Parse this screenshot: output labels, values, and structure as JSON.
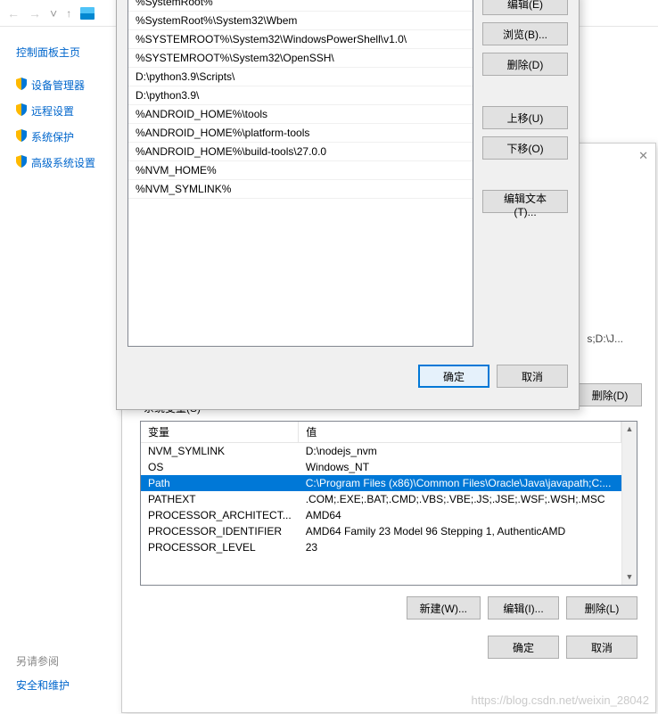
{
  "nav": {
    "back": "←",
    "forward": "→",
    "up": "↑"
  },
  "sidebar": {
    "home": "控制面板主页",
    "items": [
      {
        "label": "设备管理器"
      },
      {
        "label": "远程设置"
      },
      {
        "label": "系统保护"
      },
      {
        "label": "高级系统设置"
      }
    ],
    "footer_title": "另请参阅",
    "footer_link": "安全和维护"
  },
  "path_dialog": {
    "entries": [
      "%SystemRoot%",
      "%SystemRoot%\\System32\\Wbem",
      "%SYSTEMROOT%\\System32\\WindowsPowerShell\\v1.0\\",
      "%SYSTEMROOT%\\System32\\OpenSSH\\",
      "D:\\python3.9\\Scripts\\",
      "D:\\python3.9\\",
      "%ANDROID_HOME%\\tools",
      "%ANDROID_HOME%\\platform-tools",
      "%ANDROID_HOME%\\build-tools\\27.0.0",
      "%NVM_HOME%",
      "%NVM_SYMLINK%"
    ],
    "buttons": {
      "edit": "编辑(E)",
      "browse": "浏览(B)...",
      "delete": "删除(D)",
      "move_up": "上移(U)",
      "move_down": "下移(O)",
      "edit_text": "编辑文本(T)..."
    },
    "ok": "确定",
    "cancel": "取消"
  },
  "env_dialog": {
    "close": "✕",
    "truncated": "s;D:\\J...",
    "delete_btn": "删除(D)",
    "sys_label": "系统变量(S)",
    "columns": {
      "var": "变量",
      "val": "值"
    },
    "rows": [
      {
        "name": "NVM_SYMLINK",
        "value": "D:\\nodejs_nvm"
      },
      {
        "name": "OS",
        "value": "Windows_NT"
      },
      {
        "name": "Path",
        "value": "C:\\Program Files (x86)\\Common Files\\Oracle\\Java\\javapath;C:...",
        "selected": true
      },
      {
        "name": "PATHEXT",
        "value": ".COM;.EXE;.BAT;.CMD;.VBS;.VBE;.JS;.JSE;.WSF;.WSH;.MSC"
      },
      {
        "name": "PROCESSOR_ARCHITECT...",
        "value": "AMD64"
      },
      {
        "name": "PROCESSOR_IDENTIFIER",
        "value": "AMD64 Family 23 Model 96 Stepping 1, AuthenticAMD"
      },
      {
        "name": "PROCESSOR_LEVEL",
        "value": "23"
      }
    ],
    "buttons": {
      "new": "新建(W)...",
      "edit": "编辑(I)...",
      "delete": "删除(L)"
    },
    "ok": "确定",
    "cancel": "取消"
  },
  "watermark": "https://blog.csdn.net/weixin_28042"
}
